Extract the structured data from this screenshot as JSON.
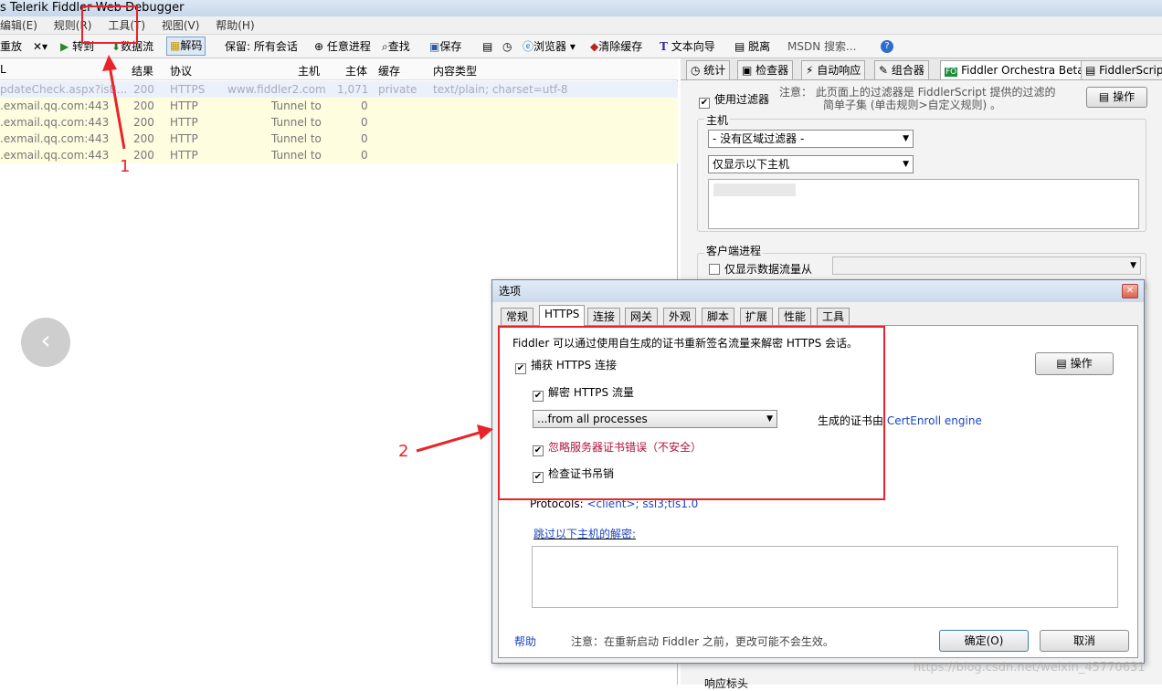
{
  "window": {
    "title": "s Telerik Fiddler Web Debugger"
  },
  "menu": [
    "编辑(E)",
    "规则(R)",
    "工具(T)",
    "视图(V)",
    "帮助(H)"
  ],
  "toolbar": {
    "replay": "重放",
    "goto": "转到",
    "stream": "数据流",
    "decode": "解码",
    "keep": "保留: 所有会话",
    "any_process": "任意进程",
    "find": "查找",
    "save": "保存",
    "browse": "浏览器",
    "clear_cache": "清除缓存",
    "text_wizard": "文本向导",
    "tearoff": "脱离",
    "msdn": "MSDN 搜索..."
  },
  "sessions": {
    "columns": [
      "L",
      "结果",
      "协议",
      "主机",
      "主体",
      "缓存",
      "内容类型"
    ],
    "rows": [
      {
        "url": "pdateCheck.aspx?isB...",
        "result": "200",
        "protocol": "HTTPS",
        "host": "www.fiddler2.com",
        "body": "1,071",
        "cache": "private",
        "type": "text/plain; charset=utf-8"
      },
      {
        "url": ".exmail.qq.com:443",
        "result": "200",
        "protocol": "HTTP",
        "host": "Tunnel to",
        "body": "0",
        "cache": "",
        "type": ""
      },
      {
        "url": ".exmail.qq.com:443",
        "result": "200",
        "protocol": "HTTP",
        "host": "Tunnel to",
        "body": "0",
        "cache": "",
        "type": ""
      },
      {
        "url": ".exmail.qq.com:443",
        "result": "200",
        "protocol": "HTTP",
        "host": "Tunnel to",
        "body": "0",
        "cache": "",
        "type": ""
      },
      {
        "url": ".exmail.qq.com:443",
        "result": "200",
        "protocol": "HTTP",
        "host": "Tunnel to",
        "body": "0",
        "cache": "",
        "type": ""
      }
    ]
  },
  "right": {
    "tabs": [
      "统计",
      "检查器",
      "自动响应",
      "组合器",
      "Fiddler Orchestra Beta",
      "FiddlerScript"
    ],
    "use_filters": "使用过滤器",
    "note": "注意： 此页面上的过滤器是 FiddlerScript 提供的过滤的",
    "note2": "简单子集 (单击规则>自定义规则) 。",
    "actions": "操作",
    "hosts_label": "主机",
    "zone_select": "- 没有区域过滤器 -",
    "host_select": "仅显示以下主机",
    "client_label": "客户端进程",
    "only_traffic": "仅显示数据流量从",
    "response_headers": "响应标头"
  },
  "dialog": {
    "title": "选项",
    "tabs": [
      "常规",
      "HTTPS",
      "连接",
      "网关",
      "外观",
      "脚本",
      "扩展",
      "性能",
      "工具"
    ],
    "intro": "Fiddler 可以通过使用自生成的证书重新签名流量来解密 HTTPS 会话。",
    "capture": "捕获 HTTPS 连接",
    "decrypt": "解密 HTTPS 流量",
    "process_select": "...from all processes",
    "ignore": "忽略服务器证书错误（不安全）",
    "revocation": "检查证书吊销",
    "cert_by": "生成的证书由",
    "cert_engine": "CertEnroll engine",
    "actions": "操作",
    "protocols_label": "Protocols:",
    "protocols_value": "<client>; ssl3;tls1.0",
    "skip": "跳过以下主机的解密:",
    "help": "帮助",
    "footer_note": "注意：在重新启动 Fiddler 之前，更改可能不会生效。",
    "ok": "确定(O)",
    "cancel": "取消"
  },
  "annotations": {
    "one": "1",
    "two": "2"
  },
  "watermark": "https://blog.csdn.net/weixin_45770631",
  "colors": {
    "annotation": "#e8242a",
    "selected_row": "#eaf1fb",
    "tunnel_row": "#fffde0"
  }
}
